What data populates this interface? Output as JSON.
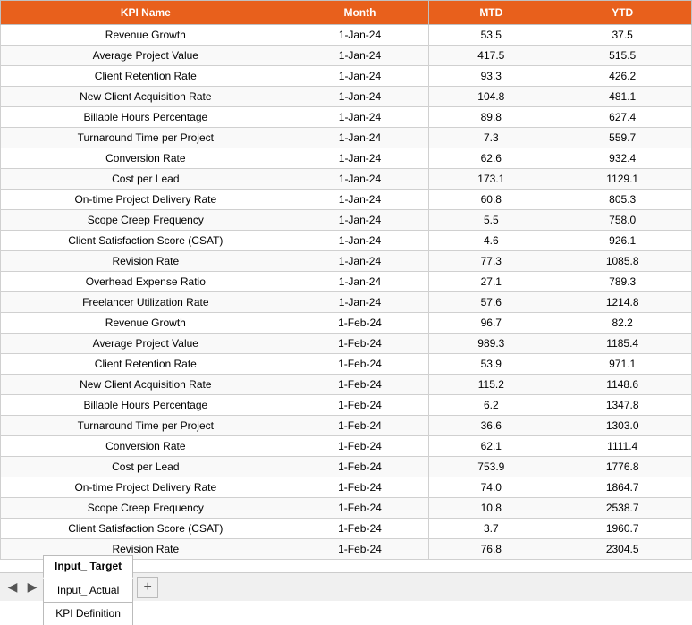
{
  "header": {
    "col_kpi": "KPI Name",
    "col_month": "Month",
    "col_mtd": "MTD",
    "col_ytd": "YTD"
  },
  "rows": [
    {
      "kpi": "Revenue Growth",
      "month": "1-Jan-24",
      "mtd": "53.5",
      "ytd": "37.5"
    },
    {
      "kpi": "Average Project Value",
      "month": "1-Jan-24",
      "mtd": "417.5",
      "ytd": "515.5"
    },
    {
      "kpi": "Client Retention Rate",
      "month": "1-Jan-24",
      "mtd": "93.3",
      "ytd": "426.2"
    },
    {
      "kpi": "New Client Acquisition Rate",
      "month": "1-Jan-24",
      "mtd": "104.8",
      "ytd": "481.1"
    },
    {
      "kpi": "Billable Hours Percentage",
      "month": "1-Jan-24",
      "mtd": "89.8",
      "ytd": "627.4"
    },
    {
      "kpi": "Turnaround Time per Project",
      "month": "1-Jan-24",
      "mtd": "7.3",
      "ytd": "559.7"
    },
    {
      "kpi": "Conversion Rate",
      "month": "1-Jan-24",
      "mtd": "62.6",
      "ytd": "932.4"
    },
    {
      "kpi": "Cost per Lead",
      "month": "1-Jan-24",
      "mtd": "173.1",
      "ytd": "1129.1"
    },
    {
      "kpi": "On-time Project Delivery Rate",
      "month": "1-Jan-24",
      "mtd": "60.8",
      "ytd": "805.3"
    },
    {
      "kpi": "Scope Creep Frequency",
      "month": "1-Jan-24",
      "mtd": "5.5",
      "ytd": "758.0"
    },
    {
      "kpi": "Client Satisfaction Score (CSAT)",
      "month": "1-Jan-24",
      "mtd": "4.6",
      "ytd": "926.1"
    },
    {
      "kpi": "Revision Rate",
      "month": "1-Jan-24",
      "mtd": "77.3",
      "ytd": "1085.8"
    },
    {
      "kpi": "Overhead Expense Ratio",
      "month": "1-Jan-24",
      "mtd": "27.1",
      "ytd": "789.3"
    },
    {
      "kpi": "Freelancer Utilization Rate",
      "month": "1-Jan-24",
      "mtd": "57.6",
      "ytd": "1214.8"
    },
    {
      "kpi": "Revenue Growth",
      "month": "1-Feb-24",
      "mtd": "96.7",
      "ytd": "82.2"
    },
    {
      "kpi": "Average Project Value",
      "month": "1-Feb-24",
      "mtd": "989.3",
      "ytd": "1185.4"
    },
    {
      "kpi": "Client Retention Rate",
      "month": "1-Feb-24",
      "mtd": "53.9",
      "ytd": "971.1"
    },
    {
      "kpi": "New Client Acquisition Rate",
      "month": "1-Feb-24",
      "mtd": "115.2",
      "ytd": "1148.6"
    },
    {
      "kpi": "Billable Hours Percentage",
      "month": "1-Feb-24",
      "mtd": "6.2",
      "ytd": "1347.8"
    },
    {
      "kpi": "Turnaround Time per Project",
      "month": "1-Feb-24",
      "mtd": "36.6",
      "ytd": "1303.0"
    },
    {
      "kpi": "Conversion Rate",
      "month": "1-Feb-24",
      "mtd": "62.1",
      "ytd": "1111.4"
    },
    {
      "kpi": "Cost per Lead",
      "month": "1-Feb-24",
      "mtd": "753.9",
      "ytd": "1776.8"
    },
    {
      "kpi": "On-time Project Delivery Rate",
      "month": "1-Feb-24",
      "mtd": "74.0",
      "ytd": "1864.7"
    },
    {
      "kpi": "Scope Creep Frequency",
      "month": "1-Feb-24",
      "mtd": "10.8",
      "ytd": "2538.7"
    },
    {
      "kpi": "Client Satisfaction Score (CSAT)",
      "month": "1-Feb-24",
      "mtd": "3.7",
      "ytd": "1960.7"
    },
    {
      "kpi": "Revision Rate",
      "month": "1-Feb-24",
      "mtd": "76.8",
      "ytd": "2304.5"
    }
  ],
  "tabs": [
    {
      "label": "Input_ Target",
      "active": true
    },
    {
      "label": "Input_ Actual",
      "active": false
    },
    {
      "label": "KPI Definition",
      "active": false
    }
  ],
  "tab_add_label": "+",
  "nav_prev": "◀",
  "nav_next": "▶"
}
